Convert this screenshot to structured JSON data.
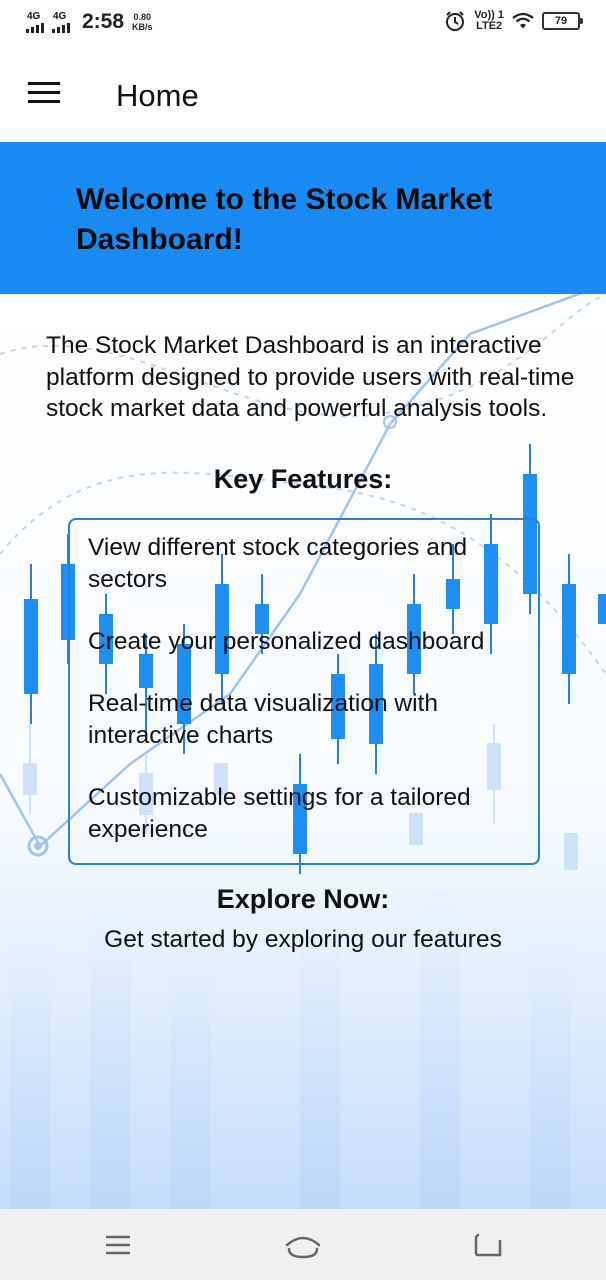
{
  "status_bar": {
    "network_1": "4G",
    "network_2": "4G",
    "time": "2:58",
    "speed_value": "0.80",
    "speed_unit": "KB/s",
    "volte_top": "Vo)) 1",
    "volte_bottom": "LTE2",
    "battery": "79",
    "icons": [
      "signal-icon",
      "alarm-icon",
      "wifi-icon",
      "battery-icon"
    ]
  },
  "app_bar": {
    "title": "Home",
    "menu_icon": "hamburger-menu-icon"
  },
  "banner": {
    "heading": "Welcome to the Stock Market Dashboard!",
    "color": "#1a8bf5"
  },
  "main": {
    "intro": "The Stock Market Dashboard is an interactive platform designed to provide users with real-time stock market data and powerful analysis tools.",
    "key_features_title": "Key Features:",
    "features": [
      "View different stock categories and sectors",
      "Create your personalized dashboard",
      "Real-time data visualization with interactive charts",
      "Customizable settings for a tailored experience"
    ],
    "explore_title": "Explore Now:",
    "explore_text": "Get started by exploring our features",
    "accent_color": "#2b7fd4"
  },
  "nav_bar": {
    "icons": [
      "recents-icon",
      "home-icon",
      "back-icon"
    ]
  }
}
